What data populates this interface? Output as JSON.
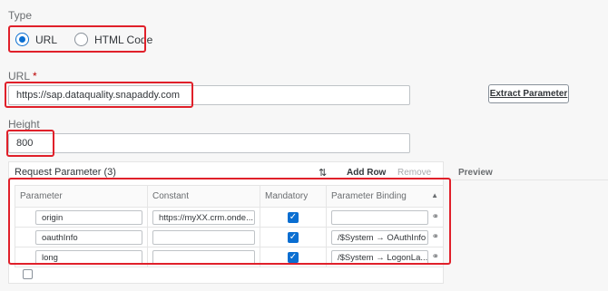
{
  "type_section": {
    "label": "Type",
    "options": [
      {
        "label": "URL",
        "selected": true
      },
      {
        "label": "HTML Code",
        "selected": false
      }
    ]
  },
  "url_section": {
    "label": "URL",
    "required_marker": "*",
    "value": "https://sap.dataquality.snapaddy.com",
    "extract_button": "Extract Parameter"
  },
  "height_section": {
    "label": "Height",
    "value": "800"
  },
  "request_parameter": {
    "title": "Request Parameter",
    "count": "(3)",
    "sort_icon": "sort-icon",
    "add_row": "Add Row",
    "remove": "Remove",
    "columns": [
      "Parameter",
      "Constant",
      "Mandatory",
      "Parameter Binding"
    ],
    "rows": [
      {
        "parameter": "origin",
        "constant": "https://myXX.crm.onde...",
        "mandatory": true,
        "binding": ""
      },
      {
        "parameter": "oauthInfo",
        "constant": "",
        "mandatory": true,
        "binding": "/$System → OAuthInfo"
      },
      {
        "parameter": "long",
        "constant": "",
        "mandatory": true,
        "binding": "/$System → LogonLa..."
      }
    ]
  },
  "preview": {
    "title": "Preview"
  },
  "colors": {
    "accent": "#0a6ed1",
    "highlight": "#e0202a"
  }
}
